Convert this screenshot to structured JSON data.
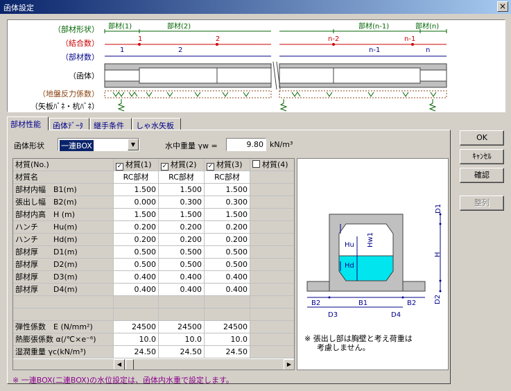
{
  "window": {
    "title": "函体設定",
    "close": "×"
  },
  "diagram": {
    "row_labels": [
      "（部材形状）",
      "（結合数）",
      "（部材数）",
      "（函体）",
      "（地盤反力係数）",
      "（矢板ﾊﾞﾈ・杭ﾊﾞﾈ）"
    ],
    "member_shape": [
      "部材(1)",
      "部材(2)",
      "部材(n-1)",
      "部材(n)"
    ],
    "joint_count": [
      "1",
      "2",
      "n-2",
      "n-1"
    ],
    "member_count": [
      "1",
      "2",
      "n-1",
      "n"
    ]
  },
  "tabs": [
    "部材性能",
    "函体ﾃﾞｰﾀ",
    "継手条件",
    "しゃ水矢板"
  ],
  "form": {
    "shape_label": "函体形状",
    "shape_value": "一連BOX",
    "weight_label": "水中重量 γw =",
    "weight_value": "9.80",
    "weight_unit": "kN/m³"
  },
  "table": {
    "headers": [
      "材質(No.)",
      "材質(1)",
      "材質(2)",
      "材質(3)",
      "材質(4)"
    ],
    "rows": [
      {
        "label": "材質名",
        "v": [
          "RC部材",
          "RC部材",
          "RC部材"
        ]
      },
      {
        "label": "部材内幅　B1(m)",
        "v": [
          "1.500",
          "1.500",
          "1.500"
        ]
      },
      {
        "label": "張出し幅　B2(m)",
        "v": [
          "0.000",
          "0.300",
          "0.300"
        ]
      },
      {
        "label": "部材内高　H (m)",
        "v": [
          "1.500",
          "1.500",
          "1.500"
        ]
      },
      {
        "label": "ハンチ　　Hu(m)",
        "v": [
          "0.200",
          "0.200",
          "0.200"
        ]
      },
      {
        "label": "ハンチ　　Hd(m)",
        "v": [
          "0.200",
          "0.200",
          "0.200"
        ]
      },
      {
        "label": "部材厚　　D1(m)",
        "v": [
          "0.500",
          "0.500",
          "0.500"
        ]
      },
      {
        "label": "部材厚　　D2(m)",
        "v": [
          "0.500",
          "0.500",
          "0.500"
        ]
      },
      {
        "label": "部材厚　　D3(m)",
        "v": [
          "0.400",
          "0.400",
          "0.400"
        ]
      },
      {
        "label": "部材厚　　D4(m)",
        "v": [
          "0.400",
          "0.400",
          "0.400"
        ]
      },
      {
        "label": "",
        "v": [
          "",
          "",
          ""
        ]
      },
      {
        "label": "",
        "v": [
          "",
          "",
          ""
        ]
      },
      {
        "label": "弾性係数　E (N/mm²)",
        "v": [
          "24500",
          "24500",
          "24500"
        ]
      },
      {
        "label": "熱膨張係数 α(/℃×e⁻⁶)",
        "v": [
          "10.0",
          "10.0",
          "10.0"
        ]
      },
      {
        "label": "湿潤重量 γc(kN/m³)",
        "v": [
          "24.50",
          "24.50",
          "24.50"
        ]
      }
    ]
  },
  "section": {
    "labels": [
      "D1",
      "H",
      "D2",
      "Hu",
      "Hd",
      "Hw1",
      "B2",
      "B1",
      "B2",
      "D3",
      "D4"
    ],
    "note1": "※ 張出し部は胸壁と考え荷重は",
    "note2": "考慮しません。"
  },
  "buttons": {
    "ok": "OK",
    "cancel": "ｷｬﾝｾﾙ",
    "confirm": "確認",
    "arrange": "整列"
  },
  "footnote": "※ 一連BOX(二連BOX)の水位設定は、函体内水重で設定します。",
  "colors": {
    "title": "#0a246a",
    "red": "#cc0000",
    "blue": "#00008b",
    "green": "#006400",
    "brown": "#8b4513",
    "water": "#00e5ee"
  }
}
